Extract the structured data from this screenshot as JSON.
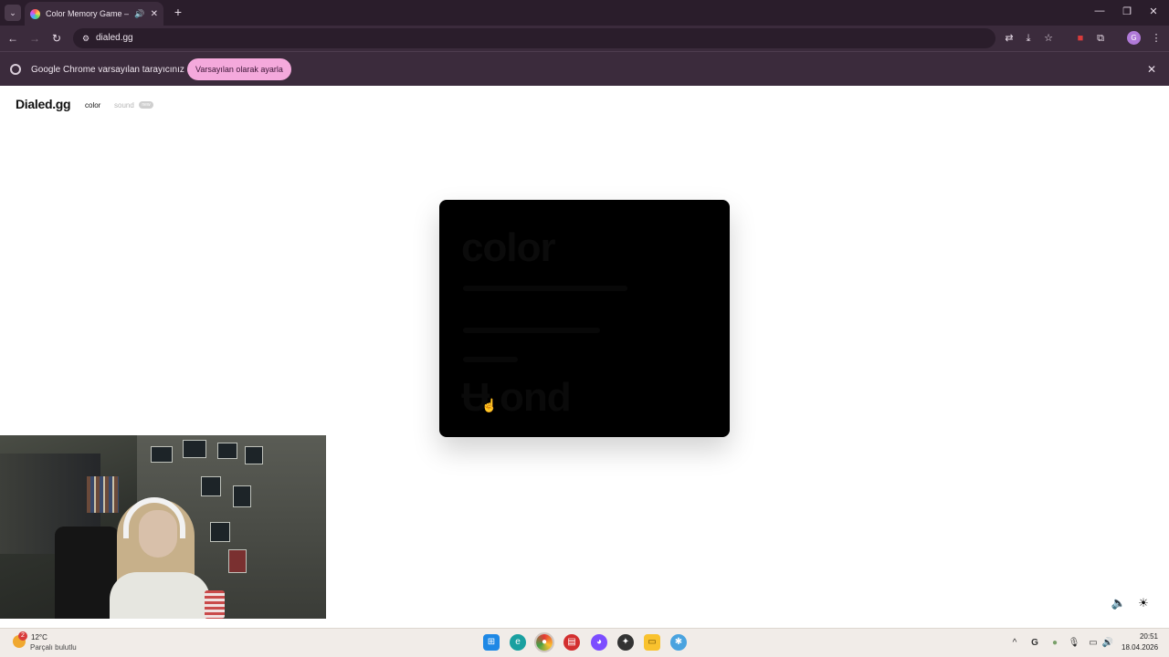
{
  "browser": {
    "tab": {
      "title": "Color Memory Game — Ho",
      "audio_icon": "speaker-icon",
      "close_label": "✕"
    },
    "tab_list_glyph": "⌄",
    "new_tab_label": "+",
    "window_controls": {
      "minimize": "—",
      "restore": "❐",
      "close": "✕"
    },
    "nav": {
      "back": "←",
      "forward": "→",
      "reload": "↻"
    },
    "url": "dialed.gg",
    "site_info_glyph": "⚙",
    "toolbar_icons": {
      "translate": "⇄",
      "install": "⤓",
      "bookmark": "☆",
      "extension_red": "■",
      "extensions": "⧉",
      "menu": "⋮"
    },
    "profile_glyph": "G",
    "infobar": {
      "message": "Google Chrome varsayılan tarayıcınız değil",
      "button_label": "Varsayılan olarak ayarla",
      "close_label": "✕"
    }
  },
  "site": {
    "brand": "Dialed.gg",
    "nav_color": "color",
    "nav_sound": "sound",
    "sound_badge": "new"
  },
  "game_card": {
    "ghost_title": "color",
    "ghost_big": "Ʉ ond"
  },
  "page_controls": {
    "volume": "🔈",
    "theme": "☀"
  },
  "taskbar": {
    "weather": {
      "badge": "2",
      "temp": "12°C",
      "desc": "Parçalı bulutlu"
    },
    "apps": [
      "windows-start",
      "edge",
      "chrome",
      "app-red",
      "discord",
      "app-dark",
      "file-explorer",
      "app-blue"
    ],
    "clock": {
      "time": "20:51",
      "date": "18.04.2026"
    }
  },
  "colors": {
    "chrome_dark": "#2a1d2b",
    "chrome_mid": "#3b2b3c",
    "infobar_button": "#f4a9dc",
    "card": "#000000"
  }
}
